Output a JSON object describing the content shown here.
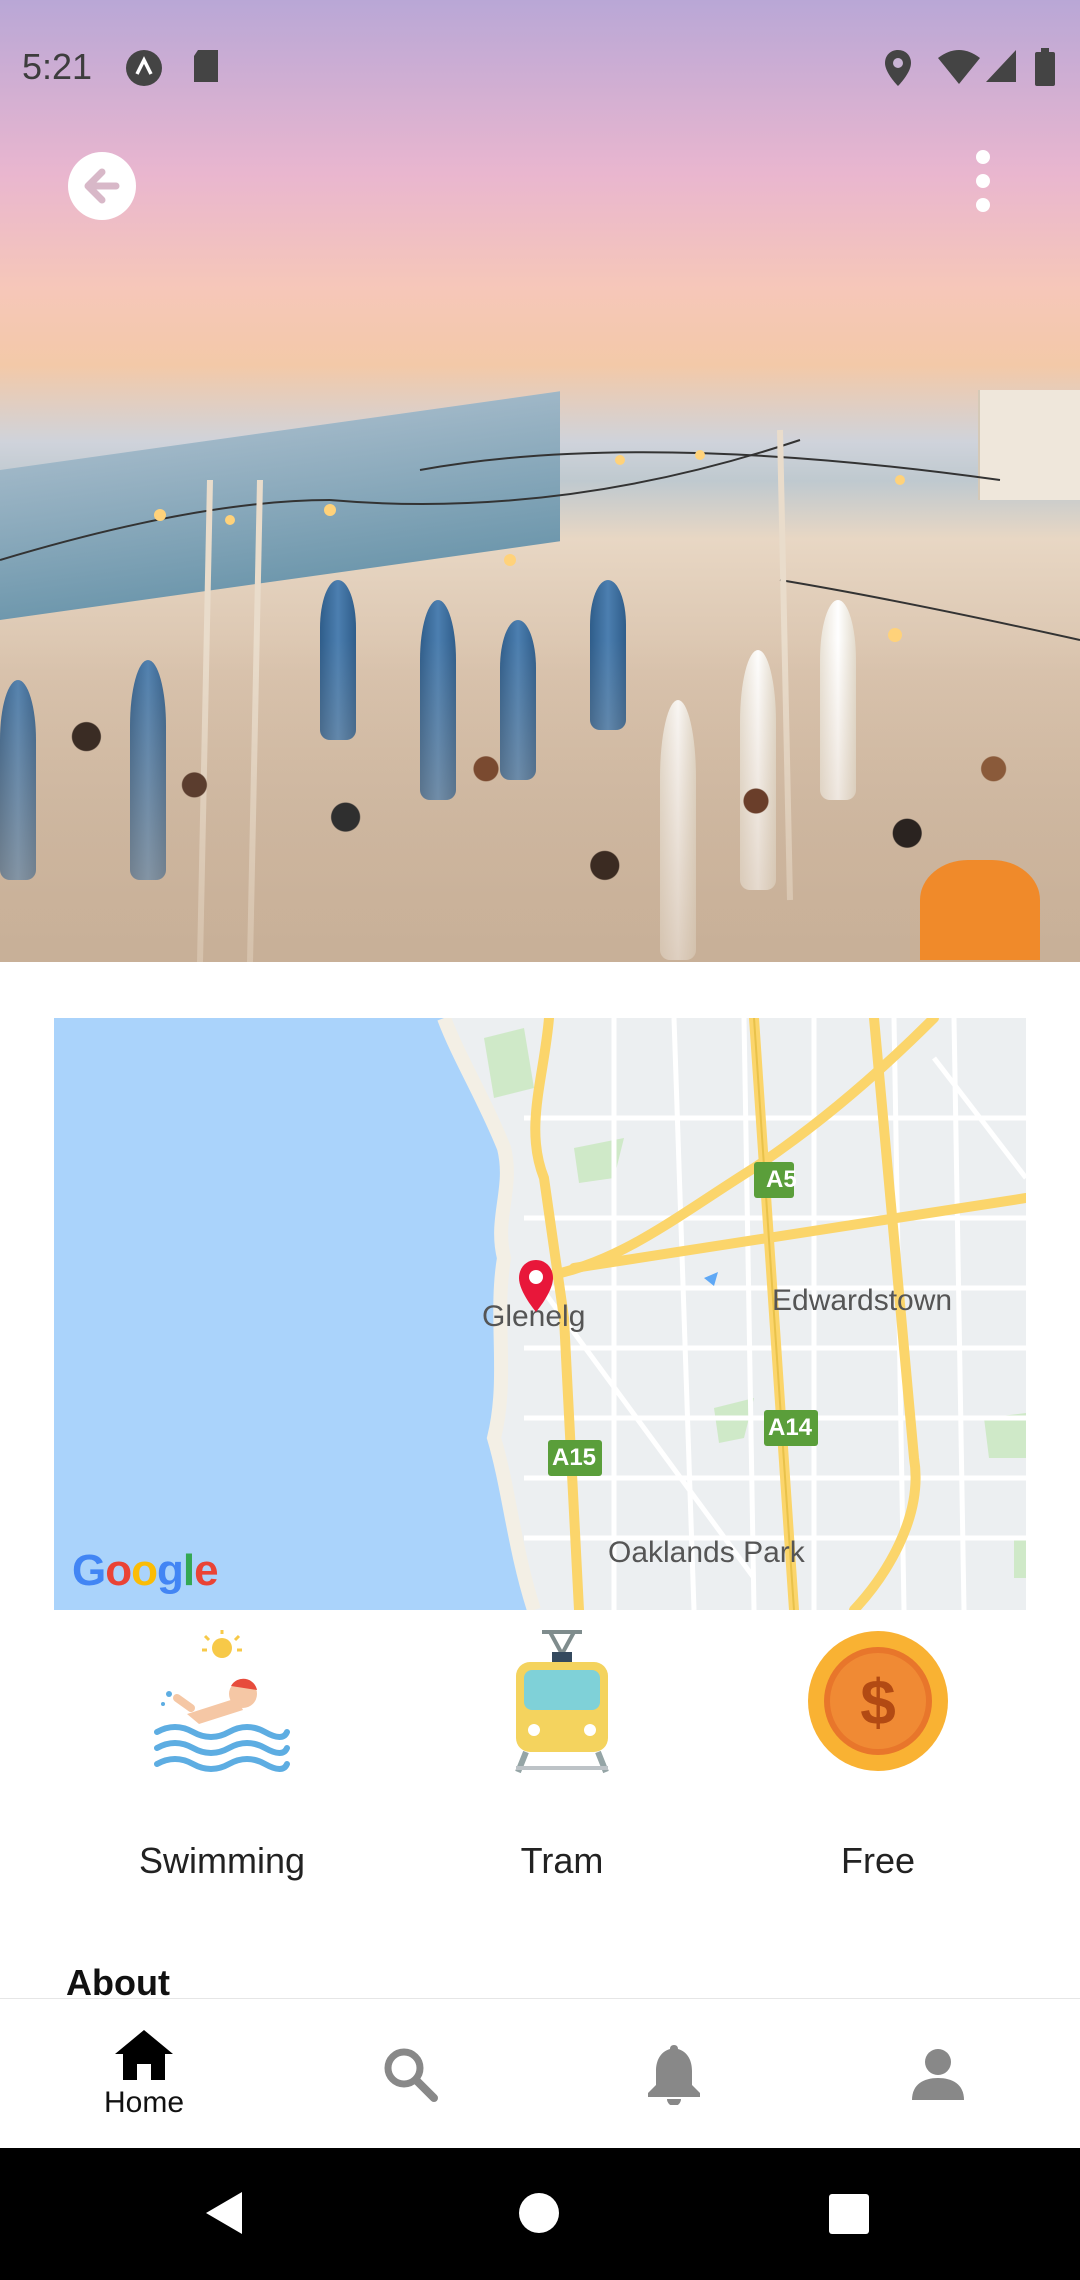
{
  "status_bar": {
    "time": "5:21"
  },
  "hero": {
    "back_icon": "arrow-left-icon",
    "menu_icon": "more-vertical-icon"
  },
  "map": {
    "labels": {
      "glenelg": "Glenelg",
      "edwardstown": "Edwardstown",
      "oaklands_park": "Oaklands Park",
      "a5": "A5",
      "a14": "A14",
      "a15": "A15"
    },
    "google_logo": "Google",
    "marker_color": "#e8173a"
  },
  "features": [
    {
      "label": "Swimming",
      "icon": "swimmer-icon"
    },
    {
      "label": "Tram",
      "icon": "tram-icon"
    },
    {
      "label": "Free",
      "icon": "dollar-coin-icon"
    }
  ],
  "about": {
    "title": "About"
  },
  "bottom_nav": {
    "items": [
      {
        "label": "Home",
        "icon": "home-icon",
        "active": true
      },
      {
        "label": "",
        "icon": "search-icon"
      },
      {
        "label": "",
        "icon": "bell-icon"
      },
      {
        "label": "",
        "icon": "person-icon"
      }
    ]
  },
  "colors": {
    "water": "#aad3fb",
    "road_yellow": "#fbd56b",
    "road_green_badge": "#5a9e3a",
    "coin_orange": "#f39c12",
    "tram_yellow": "#f4d35e"
  }
}
